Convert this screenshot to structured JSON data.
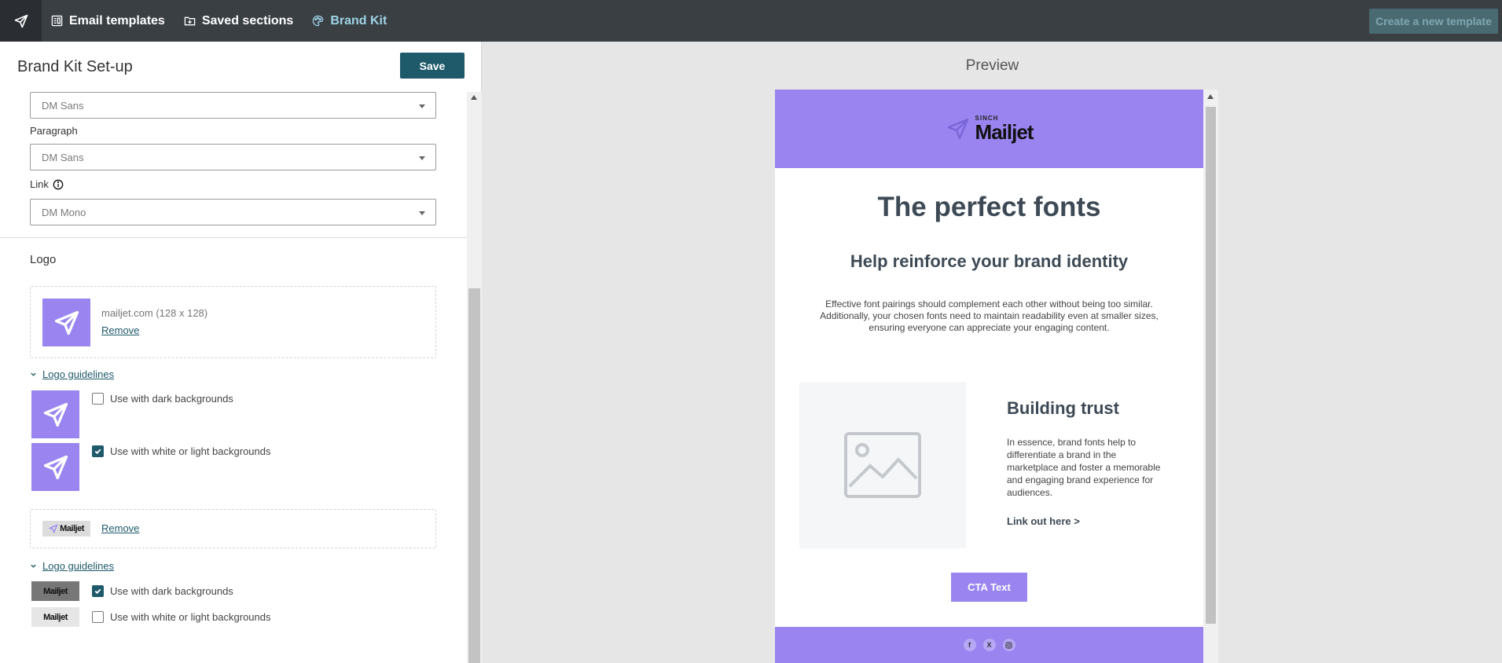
{
  "topbar": {
    "nav": [
      {
        "label": "Email templates",
        "icon": "template-icon"
      },
      {
        "label": "Saved sections",
        "icon": "saved-sections-icon"
      },
      {
        "label": "Brand Kit",
        "icon": "palette-icon",
        "active": true
      }
    ],
    "create_label": "Create a new template"
  },
  "panel": {
    "title": "Brand Kit Set-up",
    "save_label": "Save",
    "fonts": {
      "heading_value": "DM Sans",
      "paragraph_label": "Paragraph",
      "paragraph_value": "DM Sans",
      "link_label": "Link",
      "link_value": "DM Mono"
    },
    "logo": {
      "title": "Logo",
      "logo1": {
        "meta": "mailjet.com (128 x 128)",
        "remove": "Remove"
      },
      "guidelines_label": "Logo guidelines",
      "guide1": [
        {
          "label": "Use with dark backgrounds",
          "checked": false
        },
        {
          "label": "Use with white or light backgrounds",
          "checked": true
        }
      ],
      "logo2": {
        "remove": "Remove"
      },
      "guide2": [
        {
          "label": "Use with dark backgrounds",
          "checked": true
        },
        {
          "label": "Use with white or light backgrounds",
          "checked": false
        }
      ]
    }
  },
  "preview": {
    "title": "Preview",
    "brand_sinch": "SINCH",
    "brand_name": "Mailjet",
    "heading": "The perfect fonts",
    "subheading": "Help reinforce your brand identity",
    "paragraph": "Effective font pairings should complement each other without being too similar. Additionally, your chosen fonts need to maintain readability even at smaller sizes, ensuring everyone can appreciate your engaging content.",
    "section_title": "Building trust",
    "section_text": "In essence, brand fonts help to differentiate a brand in the marketplace and foster a memorable and engaging brand experience for audiences.",
    "link_text": "Link out here >",
    "cta": "CTA Text",
    "social": [
      "f",
      "X",
      "ig"
    ]
  },
  "colors": {
    "accent": "#9a85f0",
    "primary": "#1f5a6a",
    "topbar": "#3a3f44"
  }
}
